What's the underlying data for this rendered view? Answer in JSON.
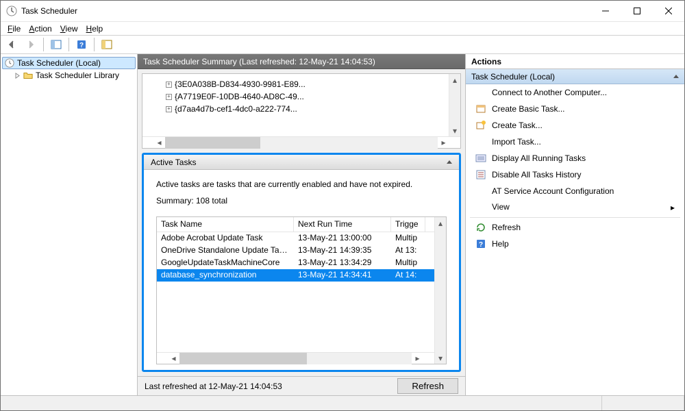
{
  "window": {
    "title": "Task Scheduler"
  },
  "menu": {
    "file": "File",
    "action": "Action",
    "view": "View",
    "help": "Help"
  },
  "tree": {
    "root": "Task Scheduler (Local)",
    "library": "Task Scheduler Library"
  },
  "summary": {
    "header": "Task Scheduler Summary (Last refreshed: 12-May-21 14:04:53)",
    "guids": [
      "{3E0A038B-D834-4930-9981-E89...",
      "{A7719E0F-10DB-4640-AD8C-49...",
      "{d7aa4d7b-cef1-4dc0-a222-774..."
    ]
  },
  "activeTasks": {
    "title": "Active Tasks",
    "desc": "Active tasks are tasks that are currently enabled and have not expired.",
    "summaryLine": "Summary: 108 total",
    "columns": {
      "name": "Task Name",
      "next": "Next Run Time",
      "trig": "Trigge"
    },
    "rows": [
      {
        "name": "Adobe Acrobat Update Task",
        "next": "13-May-21 13:00:00",
        "trig": "Multip"
      },
      {
        "name": "OneDrive Standalone Update Task-...",
        "next": "13-May-21 14:39:35",
        "trig": "At 13:"
      },
      {
        "name": "GoogleUpdateTaskMachineCore",
        "next": "13-May-21 13:34:29",
        "trig": "Multip"
      },
      {
        "name": "database_synchronization",
        "next": "13-May-21 14:34:41",
        "trig": "At 14:"
      }
    ]
  },
  "footer": {
    "last": "Last refreshed at 12-May-21 14:04:53",
    "refresh": "Refresh"
  },
  "actions": {
    "title": "Actions",
    "context": "Task Scheduler (Local)",
    "items": {
      "connect": "Connect to Another Computer...",
      "createBasic": "Create Basic Task...",
      "create": "Create Task...",
      "import": "Import Task...",
      "displayRunning": "Display All Running Tasks",
      "disableHistory": "Disable All Tasks History",
      "atService": "AT Service Account Configuration",
      "view": "View",
      "refresh": "Refresh",
      "help": "Help"
    }
  }
}
